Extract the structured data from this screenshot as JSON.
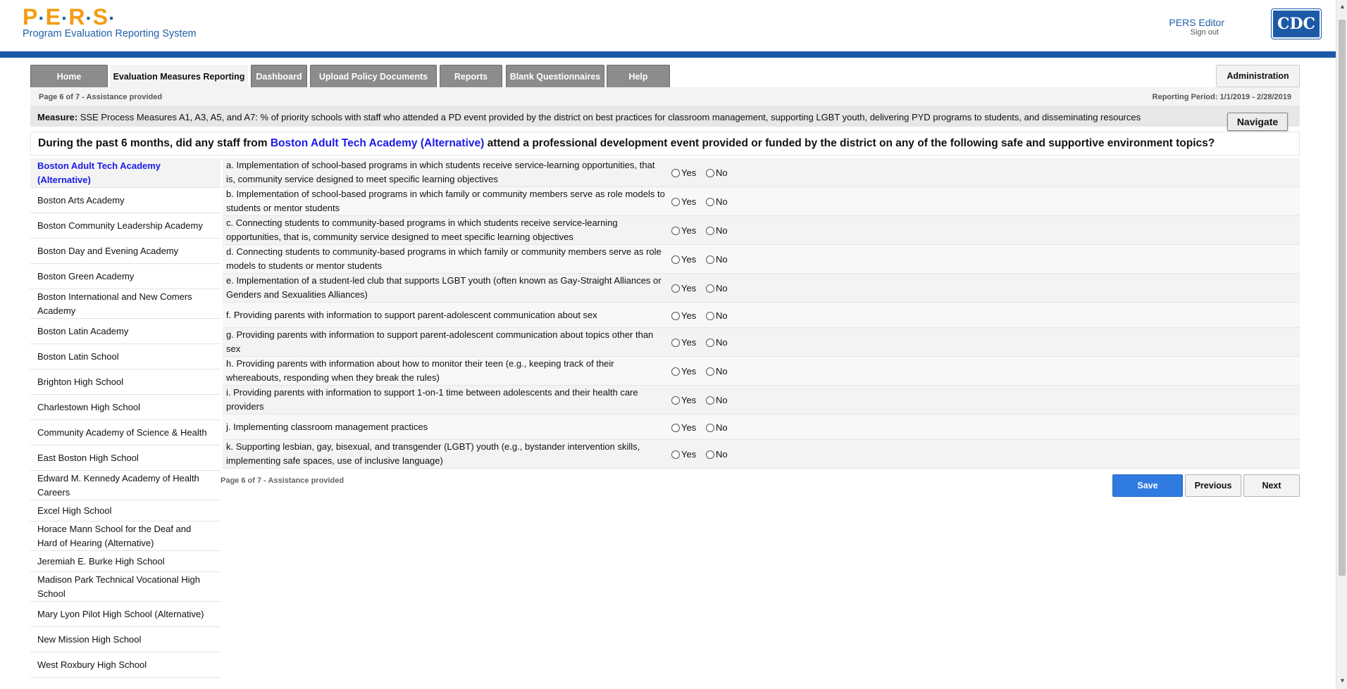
{
  "header": {
    "logo_letters": [
      "P",
      "E",
      "R",
      "S"
    ],
    "subtitle": "Program Evaluation Reporting System",
    "user_name": "PERS Editor",
    "sign_out": "Sign out",
    "cdc_logo": "CDC"
  },
  "nav": {
    "tabs": [
      {
        "label": "Home",
        "active": false
      },
      {
        "label": "Evaluation Measures Reporting",
        "active": true
      },
      {
        "label": "Dashboard",
        "active": false
      },
      {
        "label": "Upload Policy Documents",
        "active": false
      },
      {
        "label": "Reports",
        "active": false
      },
      {
        "label": "Blank Questionnaires",
        "active": false
      },
      {
        "label": "Help",
        "active": false
      }
    ],
    "admin": "Administration"
  },
  "page": {
    "indicator": "Page 6 of 7 - Assistance provided",
    "period": "Reporting Period: 1/1/2019 - 2/28/2019"
  },
  "measure": {
    "label": "Measure:",
    "text": "SSE Process Measures A1, A3, A5, and A7: % of priority schools with staff who attended a PD event provided by the district on best practices for classroom management, supporting LGBT youth, delivering PYD programs to students, and disseminating resources",
    "navigate": "Navigate"
  },
  "question": {
    "prefix": "During the past 6 months, did any staff from",
    "school": "Boston Adult Tech Academy (Alternative)",
    "suffix": "attend a professional development event provided or funded by the district on any of the following safe and supportive environment topics?"
  },
  "schools": [
    "Boston Adult Tech Academy (Alternative)",
    "Boston Arts Academy",
    "Boston Community Leadership Academy",
    "Boston Day and Evening Academy",
    "Boston Green Academy",
    "Boston International and New Comers Academy",
    "Boston Latin Academy",
    "Boston Latin School",
    "Brighton High School",
    "Charlestown High School",
    "Community Academy of Science & Health",
    "East Boston High School",
    "Edward M. Kennedy Academy of Health Careers",
    "Excel High School",
    "Horace Mann School for the Deaf and Hard of Hearing (Alternative)",
    "Jeremiah E. Burke High School",
    "Madison Park Technical Vocational High School",
    "Mary Lyon Pilot High School (Alternative)",
    "New Mission High School",
    "West Roxbury High School"
  ],
  "items": [
    "a. Implementation of school-based programs in which students receive service-learning opportunities, that is, community service designed to meet specific learning objectives",
    "b. Implementation of school-based programs in which family or community members serve as role models to students or mentor students",
    "c. Connecting students to community-based programs in which students receive service-learning opportunities, that is, community service designed to meet specific learning objectives",
    "d. Connecting students to community-based programs in which family or community members serve as role models to students or mentor students",
    "e. Implementation of a student-led club that supports LGBT youth (often known as Gay-Straight Alliances or Genders and Sexualities Alliances)",
    "f. Providing parents with information to support parent-adolescent communication about sex",
    "g. Providing parents with information to support parent-adolescent communication about topics other than sex",
    "h. Providing parents with information about how to monitor their teen (e.g., keeping track of their whereabouts, responding when they break the rules)",
    "i. Providing parents with information to support 1-on-1 time between adolescents and their health care providers",
    "j. Implementing classroom management practices",
    "k. Supporting lesbian, gay, bisexual, and transgender (LGBT) youth (e.g., bystander intervention skills, implementing safe spaces, use of inclusive language)"
  ],
  "options": {
    "yes": "Yes",
    "no": "No"
  },
  "footer": {
    "indicator": "Page 6 of 7 - Assistance provided",
    "save": "Save",
    "previous": "Previous",
    "next": "Next"
  }
}
